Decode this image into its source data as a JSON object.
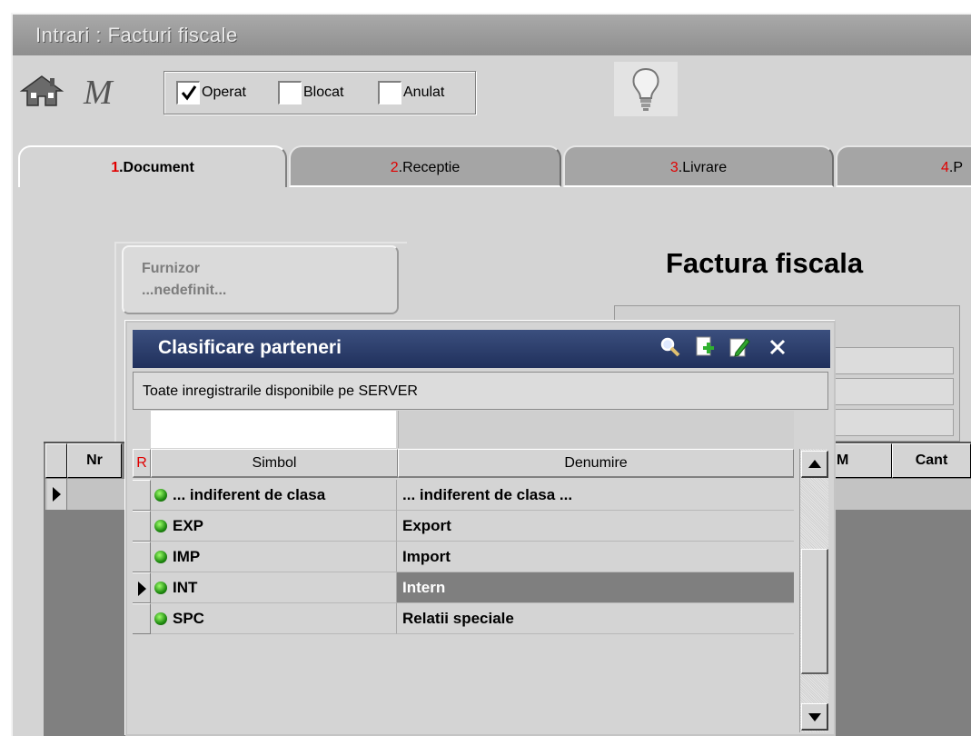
{
  "window": {
    "title": "Intrari : Facturi fiscale"
  },
  "toolbar": {
    "checkboxes": [
      {
        "label": "Operat",
        "checked": true
      },
      {
        "label": "Blocat",
        "checked": false
      },
      {
        "label": "Anulat",
        "checked": false
      }
    ],
    "icons": [
      "home-logo-icon",
      "m-logo-icon",
      "lightbulb-icon"
    ]
  },
  "tabs": [
    {
      "num": "1",
      "label": ".Document",
      "active": true
    },
    {
      "num": "2",
      "label": ".Receptie",
      "active": false
    },
    {
      "num": "3",
      "label": ".Livrare",
      "active": false
    },
    {
      "num": "4",
      "label": ".P",
      "active": false
    }
  ],
  "form": {
    "furnizor_label": "Furnizor",
    "furnizor_value": "...nedefinit...",
    "doc_title": "Factura fiscala"
  },
  "grid": {
    "columns": [
      "Nr",
      "M",
      "Cant"
    ]
  },
  "popup": {
    "title": "Clasificare parteneri",
    "status": "Toate inregistrarile disponibile pe SERVER",
    "col_r": "R",
    "col_simbol": "Simbol",
    "col_denumire": "Denumire",
    "rows": [
      {
        "simbol": "... indiferent de clasa",
        "denumire": "... indiferent de clasa ...",
        "selected": false
      },
      {
        "simbol": "EXP",
        "denumire": "Export",
        "selected": false
      },
      {
        "simbol": "IMP",
        "denumire": "Import",
        "selected": false
      },
      {
        "simbol": "INT",
        "denumire": "Intern",
        "selected": true
      },
      {
        "simbol": "SPC",
        "denumire": "Relatii speciale",
        "selected": false
      }
    ],
    "icons": [
      "search-icon",
      "add-icon",
      "edit-icon",
      "close-icon"
    ]
  },
  "colors": {
    "title_bar": "#20305c",
    "tab_number": "#e00000",
    "selection": "#7f7f7f"
  }
}
